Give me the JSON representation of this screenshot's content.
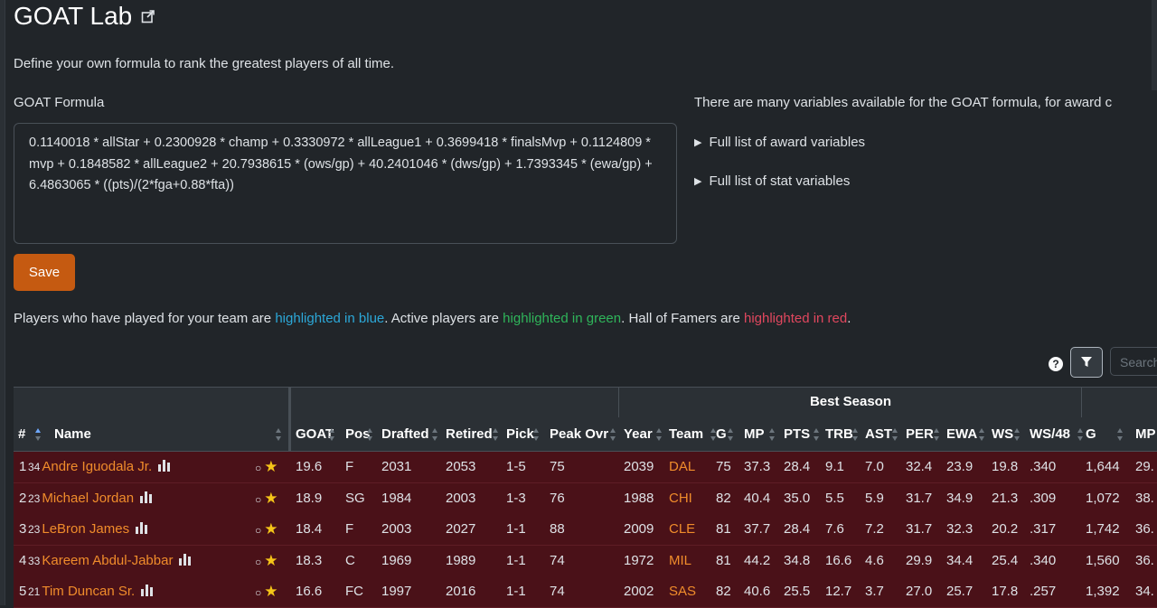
{
  "page": {
    "title": "GOAT Lab",
    "intro": "Define your own formula to rank the greatest players of all time.",
    "formula_label": "GOAT Formula",
    "formula": "0.1140018 * allStar + 0.2300928 * champ + 0.3330972 * allLeague1 + 0.3699418 * finalsMvp + 0.1124809 * mvp + 0.1848582 * allLeague2 + 20.7938615 * (ows/gp) + 40.2401046 * (dws/gp) + 1.7393345 * (ewa/gp) + 6.4863065 * ((pts)/(2*fga+0.88*fta))",
    "save_label": "Save",
    "vars_note": "There are many variables available for the GOAT formula, for award c",
    "award_vars": "Full list of award variables",
    "stat_vars": "Full list of stat variables",
    "legend": {
      "p1": "Players who have played for your team are ",
      "blue": "highlighted in blue",
      "p2": ". Active players are ",
      "green": "highlighted in green",
      "p3": ". Hall of Famers are ",
      "red": "highlighted in red",
      "p4": "."
    },
    "search_placeholder": "Search",
    "help": "?"
  },
  "table": {
    "group_best": "Best Season",
    "headers": {
      "rank": "#",
      "name": "Name",
      "goat": "GOAT",
      "pos": "Pos",
      "drafted": "Drafted",
      "retired": "Retired",
      "pick": "Pick",
      "peak": "Peak Ovr",
      "year": "Year",
      "team": "Team",
      "g": "G",
      "mp": "MP",
      "pts": "PTS",
      "trb": "TRB",
      "ast": "AST",
      "per": "PER",
      "ewa": "EWA",
      "ws": "WS",
      "ws48": "WS/48",
      "cg": "G",
      "cmp": "MP"
    },
    "rows": [
      {
        "rank": "1",
        "age": "34",
        "name": "Andre Iguodala Jr.",
        "goat": "19.6",
        "pos": "F",
        "drafted": "2031",
        "retired": "2053",
        "pick": "1-5",
        "peak": "75",
        "year": "2039",
        "team": "DAL",
        "g": "75",
        "mp": "37.3",
        "pts": "28.4",
        "trb": "9.1",
        "ast": "7.0",
        "per": "32.4",
        "ewa": "23.9",
        "ws": "19.8",
        "ws48": ".340",
        "cg": "1,644",
        "cmp": "29."
      },
      {
        "rank": "2",
        "age": "23",
        "name": "Michael Jordan",
        "goat": "18.9",
        "pos": "SG",
        "drafted": "1984",
        "retired": "2003",
        "pick": "1-3",
        "peak": "76",
        "year": "1988",
        "team": "CHI",
        "g": "82",
        "mp": "40.4",
        "pts": "35.0",
        "trb": "5.5",
        "ast": "5.9",
        "per": "31.7",
        "ewa": "34.9",
        "ws": "21.3",
        "ws48": ".309",
        "cg": "1,072",
        "cmp": "38."
      },
      {
        "rank": "3",
        "age": "23",
        "name": "LeBron James",
        "goat": "18.4",
        "pos": "F",
        "drafted": "2003",
        "retired": "2027",
        "pick": "1-1",
        "peak": "88",
        "year": "2009",
        "team": "CLE",
        "g": "81",
        "mp": "37.7",
        "pts": "28.4",
        "trb": "7.6",
        "ast": "7.2",
        "per": "31.7",
        "ewa": "32.3",
        "ws": "20.2",
        "ws48": ".317",
        "cg": "1,742",
        "cmp": "36."
      },
      {
        "rank": "4",
        "age": "33",
        "name": "Kareem Abdul-Jabbar",
        "goat": "18.3",
        "pos": "C",
        "drafted": "1969",
        "retired": "1989",
        "pick": "1-1",
        "peak": "74",
        "year": "1972",
        "team": "MIL",
        "g": "81",
        "mp": "44.2",
        "pts": "34.8",
        "trb": "16.6",
        "ast": "4.6",
        "per": "29.9",
        "ewa": "34.4",
        "ws": "25.4",
        "ws48": ".340",
        "cg": "1,560",
        "cmp": "36."
      },
      {
        "rank": "5",
        "age": "21",
        "name": "Tim Duncan Sr.",
        "goat": "16.6",
        "pos": "FC",
        "drafted": "1997",
        "retired": "2016",
        "pick": "1-1",
        "peak": "74",
        "year": "2002",
        "team": "SAS",
        "g": "82",
        "mp": "40.6",
        "pts": "25.5",
        "trb": "12.7",
        "ast": "3.7",
        "per": "27.0",
        "ewa": "25.7",
        "ws": "17.8",
        "ws48": ".257",
        "cg": "1,392",
        "cmp": "34."
      }
    ]
  },
  "colors": {
    "accent": "#c55a11",
    "link": "#f08c2b",
    "hof_row": "#4a1118",
    "star": "#f5c518"
  }
}
